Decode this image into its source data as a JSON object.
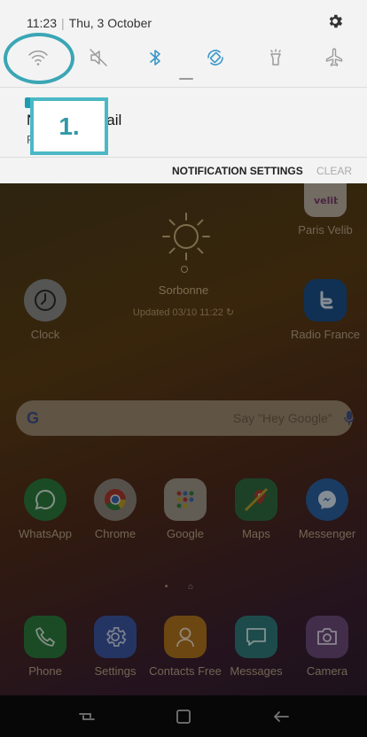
{
  "status": {
    "time": "11:23",
    "date": "Thu, 3 October"
  },
  "quick_settings": [
    {
      "name": "wifi-icon",
      "state": "off"
    },
    {
      "name": "mute-icon",
      "state": "off"
    },
    {
      "name": "bluetooth-icon",
      "state": "on"
    },
    {
      "name": "auto-rotate-icon",
      "state": "on"
    },
    {
      "name": "flashlight-icon",
      "state": "off"
    },
    {
      "name": "airplane-icon",
      "state": "off"
    }
  ],
  "notification": {
    "title_suffix": "ail",
    "sub": "F"
  },
  "notification_actions": {
    "settings": "NOTIFICATION SETTINGS",
    "clear": "CLEAR"
  },
  "step_label": "1.",
  "weather": {
    "city": "Sorbonne",
    "updated": "Updated 03/10 11:22 ↻"
  },
  "google": {
    "logo": "G",
    "hint": "Say \"Hey Google\""
  },
  "apps_top": [
    {
      "label": "Clock"
    },
    {
      "label": "Paris Velib"
    },
    {
      "label": "Radio France"
    }
  ],
  "apps_row": [
    {
      "label": "WhatsApp"
    },
    {
      "label": "Chrome"
    },
    {
      "label": "Google"
    },
    {
      "label": "Maps"
    },
    {
      "label": "Messenger"
    }
  ],
  "apps_dock": [
    {
      "label": "Phone"
    },
    {
      "label": "Settings"
    },
    {
      "label": "Contacts Free"
    },
    {
      "label": "Messages"
    },
    {
      "label": "Camera"
    }
  ],
  "page_indicator": "• ⌂",
  "colors": {
    "accent": "#3aa6b5",
    "qs_active": "#3a97c8",
    "qs_inactive": "#9b9b9b"
  }
}
